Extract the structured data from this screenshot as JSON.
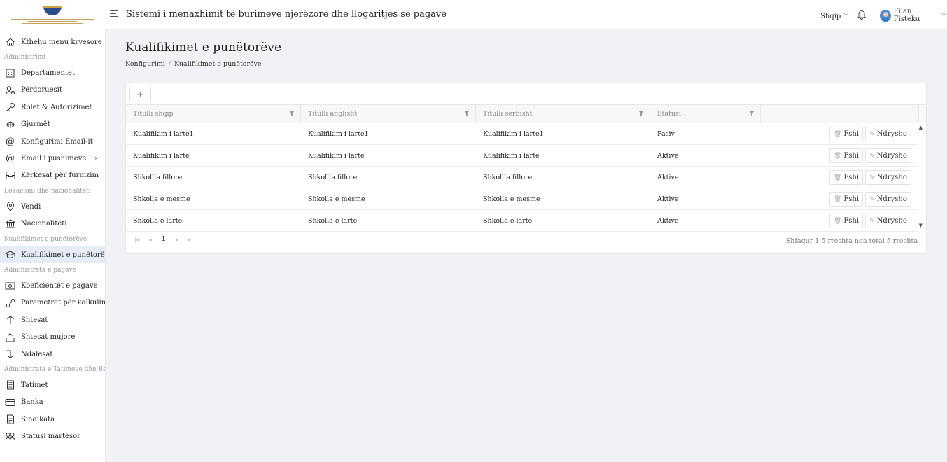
{
  "header": {
    "title": "Sistemi i menaxhimit të burimeve njerëzore dhe llogaritjes së pagave",
    "language": "Shqip",
    "user_name": "Filan Fisteku"
  },
  "sidebar": {
    "back_label": "Kthehu menu kryesore",
    "sections": [
      {
        "label": "Administrimi",
        "items": [
          {
            "label": "Departamentet",
            "icon": "building-icon"
          },
          {
            "label": "Përdoruesit",
            "icon": "user-add-icon"
          },
          {
            "label": "Rolet & Autorizimet",
            "icon": "key-icon"
          },
          {
            "label": "Gjurmët",
            "icon": "footprint-icon"
          },
          {
            "label": "Konfigurimi Email-it",
            "icon": "at-icon"
          },
          {
            "label": "Email i pushimeve",
            "icon": "at-icon"
          },
          {
            "label": "Kërkesat për furnizim",
            "icon": "inbox-icon"
          }
        ]
      },
      {
        "label": "Lokacioni dhe nacionaliteti",
        "items": [
          {
            "label": "Vendi",
            "icon": "location-icon"
          },
          {
            "label": "Nacionaliteti",
            "icon": "bank-icon"
          }
        ]
      },
      {
        "label": "Kualifikimet e punëtorëve",
        "items": [
          {
            "label": "Kualifikimet e punëtorëve",
            "icon": "graduation-icon"
          }
        ]
      },
      {
        "label": "Administrata e pagave",
        "items": [
          {
            "label": "Koeficientët e pagave",
            "icon": "money-icon"
          },
          {
            "label": "Parametrat për kalkulim",
            "icon": "branch-icon"
          },
          {
            "label": "Shtesat",
            "icon": "arrow-up-icon"
          },
          {
            "label": "Shtesat mujore",
            "icon": "upload-icon"
          },
          {
            "label": "Ndalesat",
            "icon": "arrow-down-icon"
          }
        ]
      },
      {
        "label": "Administrata e Tatimeve dhe Bank",
        "items": [
          {
            "label": "Tatimet",
            "icon": "calculator-icon"
          },
          {
            "label": "Banka",
            "icon": "card-icon"
          },
          {
            "label": "Sindikata",
            "icon": "document-icon"
          },
          {
            "label": "Statusi martesor",
            "icon": "couple-icon"
          }
        ]
      }
    ]
  },
  "page": {
    "title": "Kualifikimet e punëtorëve",
    "breadcrumb": [
      "Konfigurimi",
      "Kualifikimet e punëtorëve"
    ],
    "add_label": "+"
  },
  "table": {
    "columns": [
      "Titulli shqip",
      "Titulli anglisht",
      "Titulli serbisht",
      "Statusi"
    ],
    "rows": [
      [
        "Kualifikim i larte1",
        "Kualifikim i larte1",
        "Kualifikim i larte1",
        "Pasiv"
      ],
      [
        "Kualifikim i larte",
        "Kualifikim i larte",
        "Kualifikim i larte",
        "Aktive"
      ],
      [
        "Shkollla fillore",
        "Shkollla fillore",
        "Shkollla fillore",
        "Aktive"
      ],
      [
        "Shkolla e mesme",
        "Shkolla e mesme",
        "Shkolla e mesme",
        "Aktive"
      ],
      [
        "Shkolla e larte",
        "Shkolla e larte",
        "Shkolla e larte",
        "Aktive"
      ]
    ],
    "delete_label": "Fshi",
    "edit_label": "Ndrysho",
    "pager": {
      "current_page": "1",
      "info": "Shfaqur 1-5 rreshta nga total 5 rreshta"
    }
  }
}
